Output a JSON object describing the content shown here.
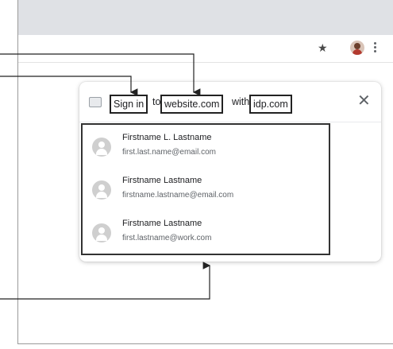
{
  "toolbar": {
    "star_icon": "star-icon",
    "menu_icon": "kebab-menu-icon"
  },
  "dialog": {
    "header": {
      "sign_in": "Sign in",
      "to": "to",
      "website": "website.com",
      "with": "with",
      "idp": "idp.com"
    },
    "close_symbol": "✕",
    "accounts": [
      {
        "name": "Firstname L. Lastname",
        "email": "first.last.name@email.com"
      },
      {
        "name": "Firstname Lastname",
        "email": "firstname.lastname@email.com"
      },
      {
        "name": "Firstname Lastname",
        "email": "first.lastname@work.com"
      }
    ]
  }
}
